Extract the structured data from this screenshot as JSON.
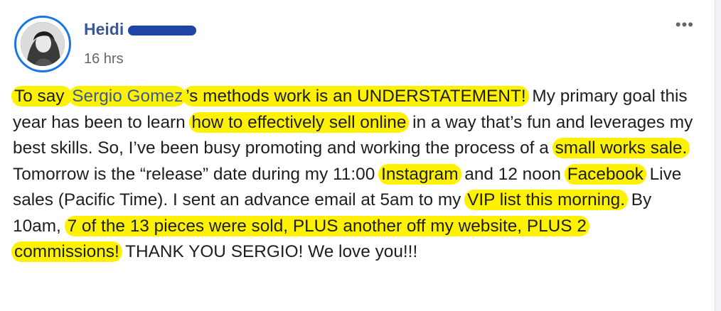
{
  "post": {
    "author": "Heidi",
    "time": "16 hrs",
    "more_icon": "ellipsis-icon",
    "segments": [
      {
        "text": "To say ",
        "hl": true
      },
      {
        "text": "Sergio Gomez",
        "hl": true,
        "mention": true
      },
      {
        "text": "’s methods work is an UNDERSTATEMENT!",
        "hl": true
      },
      {
        "text": " My primary goal this year has been to learn ",
        "hl": false
      },
      {
        "text": "how to effectively sell online",
        "hl": true
      },
      {
        "text": " in a way that’s fun and leverages my best skills. So, I’ve been busy promoting and working the process of a ",
        "hl": false
      },
      {
        "text": "small works sale.",
        "hl": true
      },
      {
        "text": " Tomorrow is the “release” date during my 11:00 ",
        "hl": false
      },
      {
        "text": "Instagram",
        "hl": true
      },
      {
        "text": " and 12 noon ",
        "hl": false
      },
      {
        "text": "Facebook",
        "hl": true
      },
      {
        "text": " Live sales (Pacific Time). I sent an advance email at 5am to my ",
        "hl": false
      },
      {
        "text": "VIP list this morning.",
        "hl": true
      },
      {
        "text": " By 10am, ",
        "hl": false
      },
      {
        "text": "7 of the 13 pieces were sold, PLUS another off my website, PLUS 2 commissions!",
        "hl": true
      },
      {
        "text": " THANK YOU SERGIO! We love you!!!",
        "hl": false
      }
    ]
  },
  "colors": {
    "highlight": "#fff200",
    "name": "#385898",
    "avatar_ring": "#1b74e4"
  }
}
